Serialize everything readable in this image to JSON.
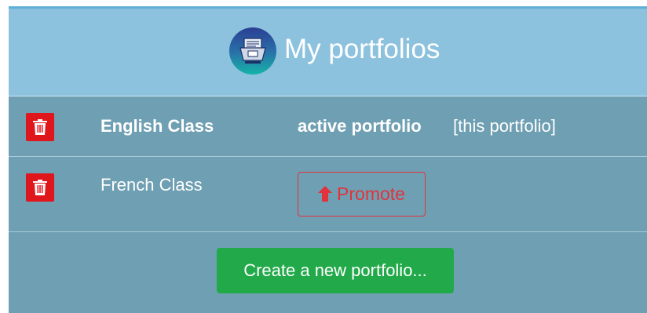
{
  "header": {
    "title": "My portfolios",
    "logo_icon": "portfolio-folder-icon"
  },
  "portfolios": [
    {
      "name": "English Class",
      "status": "active portfolio",
      "note": "[this portfolio]",
      "delete_icon": "trash-icon"
    },
    {
      "name": "French Class",
      "promote_label": "Promote",
      "promote_icon": "arrow-up-icon",
      "delete_icon": "trash-icon"
    }
  ],
  "actions": {
    "create_label": "Create a new portfolio..."
  },
  "colors": {
    "header_bg": "#8cc2de",
    "panel_bg": "#6f9fb2",
    "delete_red": "#e0161d",
    "promote_red": "#e2333c",
    "create_green": "#22a94a"
  }
}
